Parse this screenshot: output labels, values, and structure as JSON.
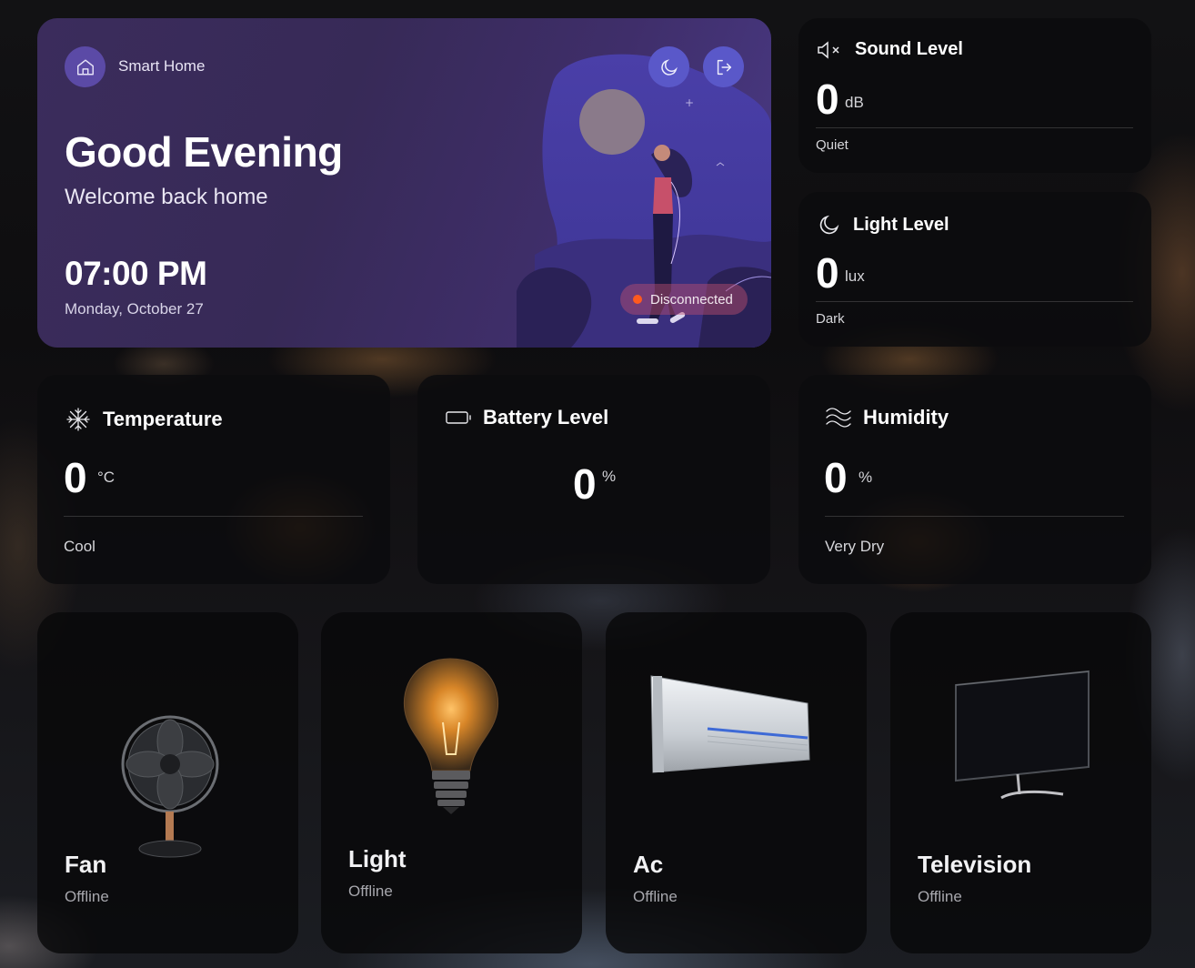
{
  "app": {
    "brand": "Smart Home",
    "greeting": "Good Evening",
    "welcome": "Welcome back home",
    "time": "07:00 PM",
    "date": "Monday, October 27",
    "connection_status": "Disconnected",
    "status_color": "#ff5a1f",
    "accent": "#5a58c9"
  },
  "sound": {
    "title": "Sound Level",
    "value": "0",
    "unit": "dB",
    "status": "Quiet",
    "icon": "speaker-muted-icon"
  },
  "light_level": {
    "title": "Light Level",
    "value": "0",
    "unit": "lux",
    "status": "Dark",
    "icon": "moon-icon"
  },
  "temperature": {
    "title": "Temperature",
    "value": "0",
    "unit": "°C",
    "status": "Cool",
    "icon": "snowflake-icon"
  },
  "battery": {
    "title": "Battery Level",
    "value": "0",
    "unit": "%",
    "icon": "battery-icon"
  },
  "humidity": {
    "title": "Humidity",
    "value": "0",
    "unit": "%",
    "status": "Very Dry",
    "icon": "waves-icon"
  },
  "devices": [
    {
      "name": "Fan",
      "status": "Offline",
      "icon": "fan-icon"
    },
    {
      "name": "Light",
      "status": "Offline",
      "icon": "light-bulb-icon"
    },
    {
      "name": "Ac",
      "status": "Offline",
      "icon": "air-conditioner-icon"
    },
    {
      "name": "Television",
      "status": "Offline",
      "icon": "television-icon"
    }
  ]
}
